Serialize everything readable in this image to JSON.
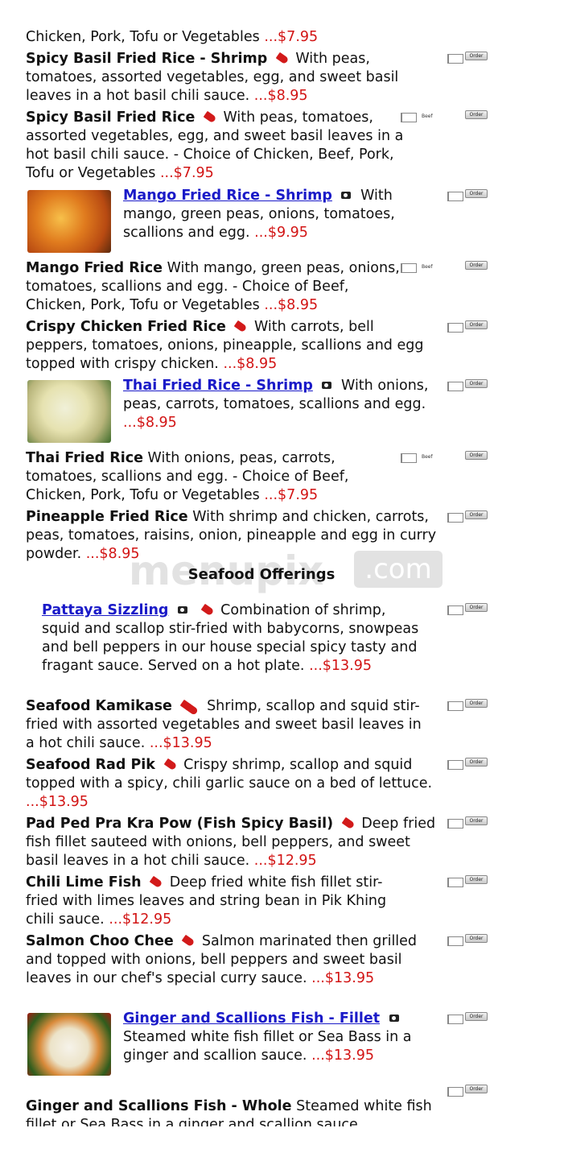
{
  "order_label": "Order",
  "select_label": "Beef",
  "section_title": "Seafood Offerings",
  "watermark": {
    "text": "menupix",
    "suffix": ".com"
  },
  "items": {
    "i0": {
      "desc": "Chicken, Pork, Tofu or Vegetables",
      "price": "...$7.95"
    },
    "i1": {
      "name": "Spicy Basil Fried Rice - Shrimp",
      "desc": "With peas, tomatoes, assorted vegetables, egg, and sweet basil leaves in a hot basil chili sauce.",
      "price": "...$8.95"
    },
    "i2": {
      "name": "Spicy Basil Fried Rice",
      "desc": "With peas, tomatoes, assorted vegetables, egg, and sweet basil leaves in a hot basil chili sauce. - Choice of Chicken, Beef, Pork, Tofu or Vegetables",
      "price": "...$7.95"
    },
    "i3": {
      "name": "Mango Fried Rice - Shrimp",
      "desc": "With mango, green peas, onions, tomatoes, scallions and egg.",
      "price": "...$9.95"
    },
    "i4": {
      "name": "Mango Fried Rice",
      "desc": "With mango, green peas, onions, tomatoes, scallions and egg. - Choice of Beef, Chicken, Pork, Tofu or Vegetables",
      "price": "...$8.95"
    },
    "i5": {
      "name": "Crispy Chicken Fried Rice",
      "desc": "With carrots, bell peppers, tomatoes, onions, pineapple, scallions and egg topped with crispy chicken.",
      "price": "...$8.95"
    },
    "i6": {
      "name": "Thai Fried Rice - Shrimp",
      "desc": "With onions, peas, carrots, tomatoes, scallions and egg.",
      "price": "...$8.95"
    },
    "i7": {
      "name": "Thai Fried Rice",
      "desc": "With onions, peas, carrots, tomatoes, scallions and egg. - Choice of Beef, Chicken, Pork, Tofu or Vegetables",
      "price": "...$7.95"
    },
    "i8": {
      "name": "Pineapple Fried Rice",
      "desc": "With shrimp and chicken, carrots, peas, tomatoes, raisins, onion, pineapple and egg in curry powder.",
      "price": "...$8.95"
    },
    "i9": {
      "name": "Pattaya Sizzling",
      "desc": "Combination of shrimp, squid and scallop stir-fried with babycorns, snowpeas and bell peppers in our house special spicy tasty and fragant sauce. Served on a hot plate.",
      "price": "...$13.95"
    },
    "i10": {
      "name": "Seafood Kamikase",
      "desc": "Shrimp, scallop and squid stir-fried with assorted vegetables and sweet basil leaves in a hot chili sauce.",
      "price": "...$13.95"
    },
    "i11": {
      "name": "Seafood Rad Pik",
      "desc": "Crispy shrimp, scallop and squid topped with a spicy, chili garlic sauce on a bed of lettuce.",
      "price": "...$13.95"
    },
    "i12": {
      "name": "Pad Ped Pra Kra Pow (Fish Spicy Basil)",
      "desc": "Deep fried fish fillet sauteed with onions, bell peppers, and sweet basil leaves in a hot chili sauce.",
      "price": "...$12.95"
    },
    "i13": {
      "name": "Chili Lime Fish",
      "desc": "Deep fried white fish fillet stir-fried with limes leaves and string bean in Pik Khing chili sauce.",
      "price": "...$12.95"
    },
    "i14": {
      "name": "Salmon Choo Chee",
      "desc": "Salmon marinated then grilled and topped with onions, bell peppers and sweet basil leaves in our chef's special curry sauce.",
      "price": "...$13.95"
    },
    "i15": {
      "name": "Ginger and Scallions Fish - Fillet",
      "desc": "Steamed white fish fillet or Sea Bass in a ginger and scallion sauce.",
      "price": "...$13.95"
    },
    "i16": {
      "name": "Ginger and Scallions Fish - Whole",
      "desc": "Steamed white fish fillet or Sea Bass in a ginger and scallion sauce"
    }
  }
}
